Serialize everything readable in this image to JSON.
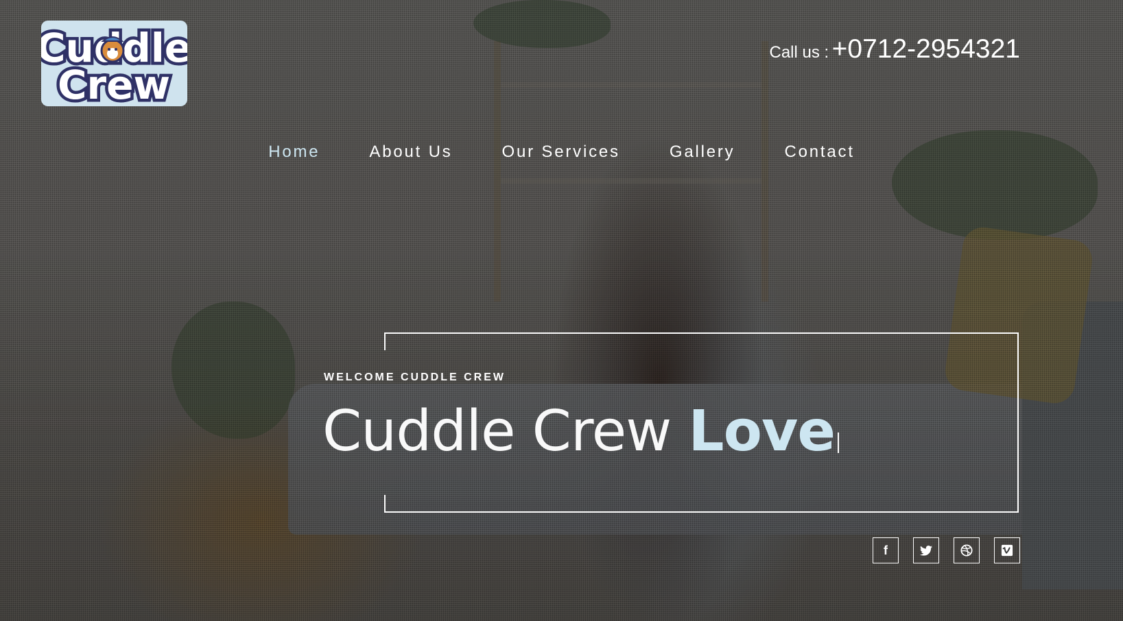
{
  "brand": {
    "logo_line1": "Cuddle",
    "logo_line2": "Crew"
  },
  "header": {
    "call_label": "Call us :",
    "phone_number": "+0712-2954321"
  },
  "nav": {
    "items": [
      {
        "label": "Home",
        "active": true
      },
      {
        "label": "About Us",
        "active": false
      },
      {
        "label": "Our Services",
        "active": false
      },
      {
        "label": "Gallery",
        "active": false
      },
      {
        "label": "Contact",
        "active": false
      }
    ]
  },
  "hero": {
    "eyebrow": "WELCOME CUDDLE CREW",
    "headline_light": "Cuddle Crew",
    "headline_bold": "Love"
  },
  "social": [
    {
      "icon": "facebook-icon",
      "glyph": "f"
    },
    {
      "icon": "twitter-icon",
      "glyph": "🐦"
    },
    {
      "icon": "dribbble-icon",
      "glyph": "◍"
    },
    {
      "icon": "vimeo-icon",
      "glyph": "v"
    }
  ],
  "colors": {
    "accent": "#cde6f1",
    "text": "#ffffff",
    "logo_bg": "#cfe3ee",
    "logo_text": "#2f3166"
  }
}
